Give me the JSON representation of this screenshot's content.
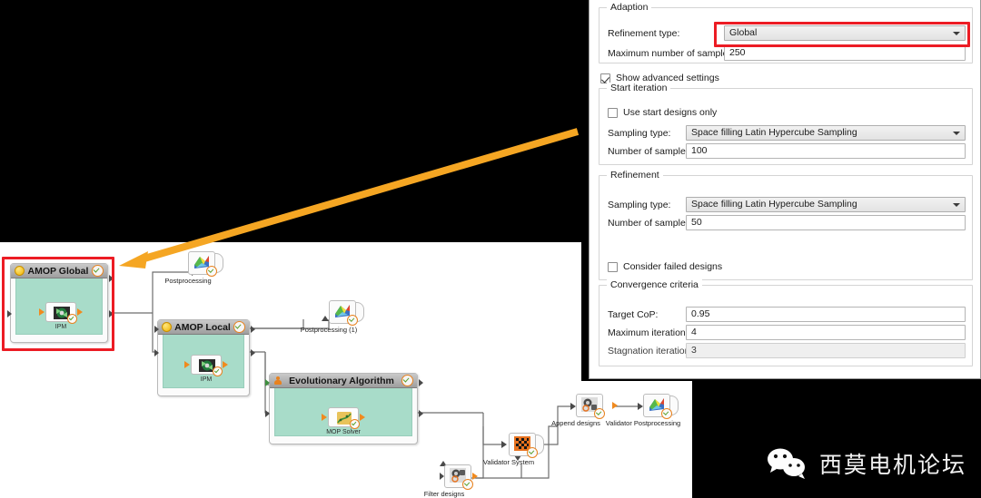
{
  "dialog": {
    "adaption": {
      "legend": "Adaption",
      "refinement_type_label": "Refinement type:",
      "refinement_type_value": "Global",
      "max_samples_label": "Maximum number of samples:",
      "max_samples_value": "250"
    },
    "show_advanced": {
      "label": "Show advanced settings",
      "checked": true
    },
    "start_iteration": {
      "legend": "Start iteration",
      "use_start_designs_label": "Use start designs only",
      "use_start_designs_checked": false,
      "sampling_type_label": "Sampling type:",
      "sampling_type_value": "Space filling Latin Hypercube Sampling",
      "num_samples_label": "Number of samples:",
      "num_samples_value": "100"
    },
    "refinement": {
      "legend": "Refinement",
      "sampling_type_label": "Sampling type:",
      "sampling_type_value": "Space filling Latin Hypercube Sampling",
      "num_samples_label": "Number of samples:",
      "num_samples_value": "50",
      "consider_failed_label": "Consider failed designs",
      "consider_failed_checked": false
    },
    "convergence": {
      "legend": "Convergence criteria",
      "target_cop_label": "Target CoP:",
      "target_cop_value": "0.95",
      "max_iterations_label": "Maximum iterations:",
      "max_iterations_value": "4",
      "stagnation_label": "Stagnation iterations:",
      "stagnation_value": "3"
    },
    "highlight_color": "#ec1c24"
  },
  "workflow": {
    "systems": [
      {
        "title": "AMOP Global",
        "inner_label": "IPM",
        "header_icon": "bulb-icon",
        "status_icon": "check-badge-icon"
      },
      {
        "title": "AMOP Local",
        "inner_label": "IPM",
        "header_icon": "bulb-icon",
        "status_icon": "check-badge-icon"
      },
      {
        "title": "Evolutionary Algorithm",
        "inner_label": "MOP Solver",
        "header_icon": "person-icon",
        "status_icon": "check-badge-icon"
      }
    ],
    "nodes": [
      {
        "label": "Postprocessing",
        "icon": "surface-plot-icon"
      },
      {
        "label": "Postprocessing (1)",
        "icon": "surface-plot-icon"
      },
      {
        "label": "Validator System",
        "icon": "checkerboard-icon"
      },
      {
        "label": "Append designs",
        "icon": "append-designs-icon"
      },
      {
        "label": "Validator Postprocessing",
        "icon": "surface-plot-icon"
      },
      {
        "label": "Filter designs",
        "icon": "filter-designs-icon"
      }
    ],
    "selection_color": "#ec1c24",
    "node_body_color": "#a8dcc9",
    "annotation_arrow_color": "#f5a623"
  },
  "watermark": {
    "text": "西莫电机论坛",
    "icon": "wechat-icon"
  }
}
